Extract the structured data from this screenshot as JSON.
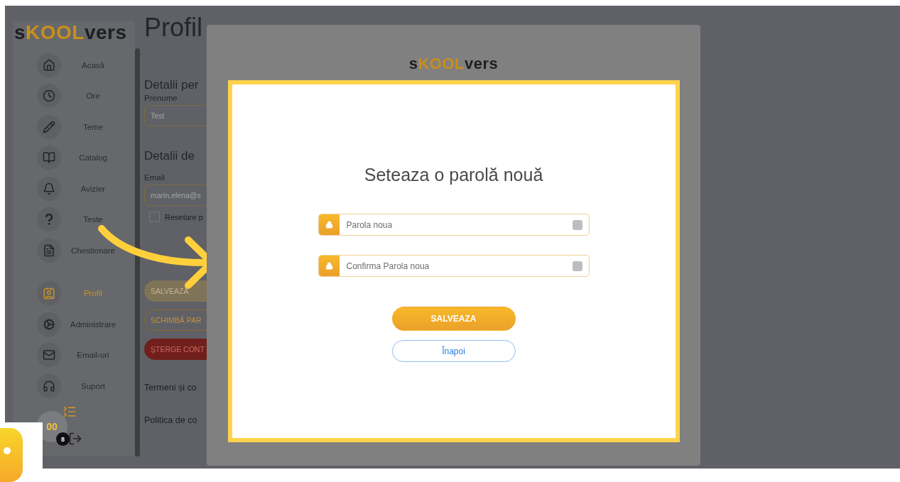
{
  "sidebar": {
    "logo": {
      "start": "s",
      "middle": "KOOL",
      "end": "vers"
    },
    "groups": [
      [
        {
          "label": "Acasă",
          "selected": false
        },
        {
          "label": "Ore",
          "selected": false
        },
        {
          "label": "Teme",
          "selected": false
        },
        {
          "label": "Catalog",
          "selected": false
        },
        {
          "label": "Avizier",
          "selected": false
        },
        {
          "label": "Teste",
          "selected": false
        },
        {
          "label": "Chestionare",
          "selected": false
        }
      ],
      [
        {
          "label": "Profil",
          "selected": true
        },
        {
          "label": "Administrare",
          "selected": false
        },
        {
          "label": "Email-uri",
          "selected": false
        },
        {
          "label": "Suport",
          "selected": false
        }
      ]
    ],
    "avatar": {
      "initials": "00",
      "badge": "8"
    }
  },
  "page": {
    "title": "Profil",
    "blocks": [
      {
        "kind": "heading",
        "text": "Detalii per"
      },
      {
        "kind": "label",
        "text": "Prenume"
      },
      {
        "kind": "field",
        "placeholder": "Test"
      },
      {
        "kind": "heading",
        "text": "Detalii de"
      },
      {
        "kind": "label",
        "text": "Email"
      },
      {
        "kind": "field",
        "placeholder": "marin.elena@s"
      },
      {
        "kind": "checkbox",
        "text": "Resetare p",
        "checked": false
      },
      {
        "kind": "filled",
        "text": "SALVEAZĂ",
        "disabled": true
      },
      {
        "kind": "outline",
        "text": "SCHIMBĂ PAR"
      },
      {
        "kind": "danger",
        "text": "ŞTERGE CONT"
      },
      {
        "kind": "link",
        "text": "Termeni și co"
      },
      {
        "kind": "link",
        "text": "Politica de co"
      }
    ]
  },
  "modal": {
    "logo": {
      "start": "s",
      "middle": "KOOL",
      "end": "vers"
    },
    "title": "Seteaza o parolă nouă",
    "fields": [
      {
        "placeholder": "Parola noua"
      },
      {
        "placeholder": "Confirma Parola noua"
      }
    ],
    "buttons": [
      {
        "label": "SALVEAZA",
        "kind": "primary"
      },
      {
        "label": "Înapoi",
        "kind": "secondary"
      }
    ]
  }
}
